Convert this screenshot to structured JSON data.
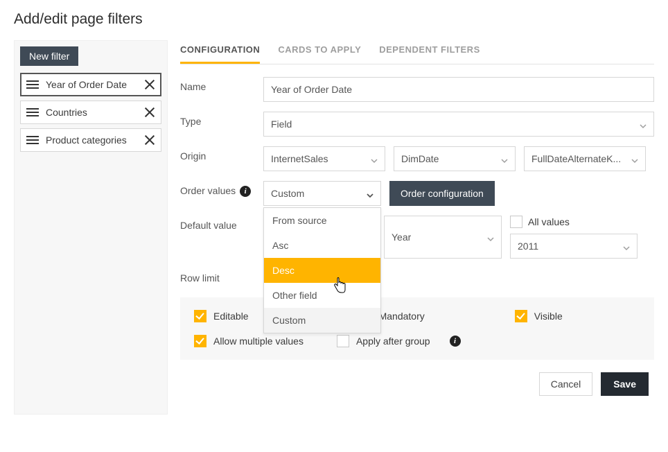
{
  "title": "Add/edit page filters",
  "sidebar": {
    "new_filter": "New filter",
    "items": [
      {
        "label": "Year of Order Date",
        "active": true
      },
      {
        "label": "Countries",
        "active": false
      },
      {
        "label": "Product categories",
        "active": false
      }
    ]
  },
  "tabs": {
    "config": "Configuration",
    "cards": "Cards to apply",
    "deps": "Dependent filters"
  },
  "labels": {
    "name": "Name",
    "type": "Type",
    "origin": "Origin",
    "order_values": "Order values",
    "default_value": "Default value",
    "row_limit": "Row limit"
  },
  "fields": {
    "name_value": "Year of Order Date",
    "type_value": "Field",
    "origin_1": "InternetSales",
    "origin_2": "DimDate",
    "origin_3": "FullDateAlternateK...",
    "order_value": "Custom",
    "order_config_btn": "Order configuration",
    "default_period": "Year",
    "default_value": "2011",
    "all_values": "All values"
  },
  "order_dropdown": {
    "items": [
      "From source",
      "Asc",
      "Desc",
      "Other field",
      "Custom"
    ],
    "hover": "Desc",
    "selected": "Custom"
  },
  "options": {
    "editable": "Editable",
    "mandatory": "Mandatory",
    "visible": "Visible",
    "allow_multiple": "Allow multiple values",
    "apply_after_group": "Apply after group"
  },
  "footer": {
    "cancel": "Cancel",
    "save": "Save"
  }
}
